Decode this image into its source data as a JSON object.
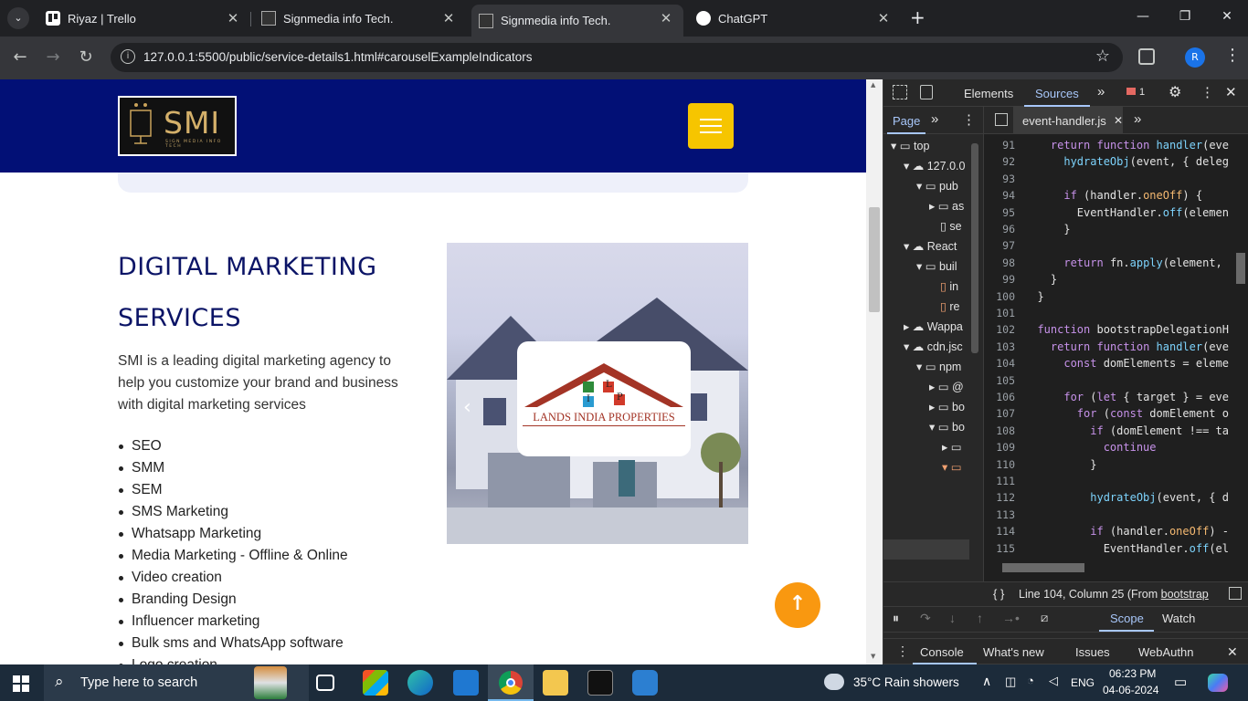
{
  "browser": {
    "tabs": [
      {
        "title": "Riyaz | Trello",
        "active": false
      },
      {
        "title": "Signmedia info Tech.",
        "active": false
      },
      {
        "title": "Signmedia info Tech.",
        "active": true
      },
      {
        "title": "ChatGPT",
        "active": false
      }
    ],
    "new_tab_icon": "+",
    "url": "127.0.0.1:5500/public/service-details1.html#carouselExampleIndicators",
    "profile_initial": "R"
  },
  "site": {
    "logo_text": "SMI",
    "logo_subtitle": "SIGN MEDIA INFO TECH",
    "heading_line1": "DIGITAL MARKETING",
    "heading_line2": "SERVICES",
    "intro": "SMI is a leading digital marketing agency to help you customize your brand and business with digital marketing services",
    "services": [
      "SEO",
      "SMM",
      "SEM",
      "SMS Marketing",
      "Whatsapp Marketing",
      "Media Marketing - Offline & Online",
      "Video creation",
      "Branding Design",
      "Influencer marketing",
      "Bulk sms and WhatsApp software",
      "Logo creation"
    ],
    "carousel_logo_text": "LANDS INDIA PROPERTIES",
    "carousel_logo_letters": [
      "L",
      "I",
      "P"
    ],
    "accent": "#021076",
    "button_color": "#f6c500",
    "scroll_top_color": "#f99810"
  },
  "devtools": {
    "tabs": [
      "Elements",
      "Sources"
    ],
    "active_tab": "Sources",
    "issues_count": "1",
    "nav_tab": "Page",
    "file_tab": "event-handler.js",
    "tree": [
      "top",
      "127.0.0",
      "pub",
      "as",
      "se",
      "React",
      "buil",
      "in",
      "re",
      "Wappa",
      "cdn.jsc",
      "npm",
      "@",
      "bo",
      "bo"
    ],
    "code_lines": [
      {
        "n": "91",
        "t": "    return function handler(eve"
      },
      {
        "n": "92",
        "t": "      hydrateObj(event, { deleg"
      },
      {
        "n": "93",
        "t": ""
      },
      {
        "n": "94",
        "t": "      if (handler.oneOff) {"
      },
      {
        "n": "95",
        "t": "        EventHandler.off(elemen"
      },
      {
        "n": "96",
        "t": "      }"
      },
      {
        "n": "97",
        "t": ""
      },
      {
        "n": "98",
        "t": "      return fn.apply(element,"
      },
      {
        "n": "99",
        "t": "    }"
      },
      {
        "n": "100",
        "t": "  }"
      },
      {
        "n": "101",
        "t": ""
      },
      {
        "n": "102",
        "t": "  function bootstrapDelegationH"
      },
      {
        "n": "103",
        "t": "    return function handler(eve"
      },
      {
        "n": "104",
        "t": "      const domElements = eleme"
      },
      {
        "n": "105",
        "t": ""
      },
      {
        "n": "106",
        "t": "      for (let { target } = eve"
      },
      {
        "n": "107",
        "t": "        for (const domElement o"
      },
      {
        "n": "108",
        "t": "          if (domElement !== ta"
      },
      {
        "n": "109",
        "t": "            continue"
      },
      {
        "n": "110",
        "t": "          }"
      },
      {
        "n": "111",
        "t": ""
      },
      {
        "n": "112",
        "t": "          hydrateObj(event, { d"
      },
      {
        "n": "113",
        "t": ""
      },
      {
        "n": "114",
        "t": "          if (handler.oneOff) -"
      },
      {
        "n": "115",
        "t": "            EventHandler.off(el"
      }
    ],
    "status": "Line 104, Column 25  (From ",
    "status_link": "bootstrap",
    "panel_tabs": [
      "Scope",
      "Watch"
    ],
    "drawer_tabs": [
      "Console",
      "What's new",
      "Issues",
      "WebAuthn"
    ]
  },
  "taskbar": {
    "search_placeholder": "Type here to search",
    "weather": "35°C  Rain showers",
    "lang": "ENG",
    "time": "06:23 PM",
    "date": "04-06-2024"
  }
}
